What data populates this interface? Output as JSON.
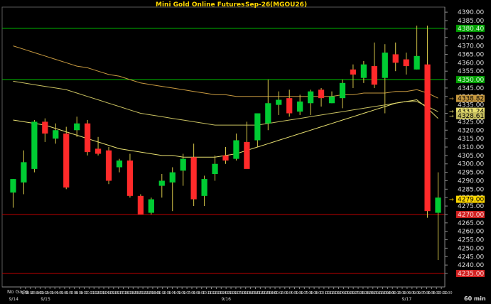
{
  "header": {
    "product": "Mini Gold Online Futures",
    "contract": "Sep-26",
    "symbol": "(MGOU26)"
  },
  "footer": {
    "gaps_label": "No Gaps",
    "interval_label": "60 min"
  },
  "colors": {
    "background": "#000000",
    "up_candle": "#00cc33",
    "down_candle": "#ff2a2a",
    "wick": "#d8c84a",
    "ma_fast": "#e8e070",
    "ma_mid": "#c8c060",
    "ma_slow": "#c89a40",
    "resistance_line": "#00c000",
    "support_line": "#c00000",
    "grid": "#5a5a5a"
  },
  "chart_data": {
    "type": "candlestick",
    "title": "Mini Gold Online Futures  Sep-26  (MGOU26)",
    "interval": "60 min",
    "ylim": [
      4227,
      4393
    ],
    "y_ticks": [
      4235,
      4240,
      4245,
      4250,
      4255,
      4260,
      4265,
      4270,
      4275,
      4280,
      4285,
      4290,
      4295,
      4300,
      4305,
      4310,
      4315,
      4320,
      4325,
      4330,
      4335,
      4340,
      4345,
      4350,
      4355,
      4360,
      4365,
      4370,
      4375,
      4380,
      4385,
      4390
    ],
    "date_labels": [
      {
        "bar": 0,
        "label": "9/14"
      },
      {
        "bar": 3,
        "label": "9/15"
      },
      {
        "bar": 20,
        "label": "9/16"
      },
      {
        "bar": 37,
        "label": "9/17"
      }
    ],
    "time_labels": [
      "1:00",
      "2:00",
      "23:00",
      "0:00",
      "1:00",
      "2:00",
      "3:00",
      "4:00",
      "5:00",
      "6:00",
      "7:00",
      "8:00",
      "9:00",
      "10:00",
      "11:00",
      "12:00",
      "13:00",
      "14:00",
      "15:00",
      "16:00",
      "17:00",
      "18:00",
      "19:00",
      "20:00",
      "21:00",
      "22:00",
      "23:00",
      "0:00",
      "1:00",
      "2:00",
      "3:00",
      "4:00",
      "5:00",
      "6:00",
      "7:00",
      "8:00",
      "9:00",
      "10:00",
      "11:00",
      "12:00",
      "13:00",
      "14:00",
      "15:00",
      "16:00",
      "17:00",
      "18:00",
      "19:00",
      "20:00",
      "21:00",
      "22:00",
      "23:00",
      "0:00",
      "1:00",
      "2:00",
      "3:00",
      "4:00",
      "5:00",
      "6:00",
      "7:00",
      "8:00",
      "9:00",
      "10:00",
      "11:00",
      "12:00",
      "13:00",
      "14:00",
      "15:00",
      "16:00",
      "17:00",
      "18:00",
      "19:00",
      "20:00",
      "21:00",
      "22:00",
      "23:00",
      "0:00",
      "1:00",
      "2:00",
      "3:00",
      "4:00",
      "5:00",
      "6:00",
      "7:00",
      "8:00",
      "9:00",
      "10:00",
      "11:00"
    ],
    "candles": [
      {
        "o": 4283,
        "h": 4291,
        "l": 4274,
        "c": 4291
      },
      {
        "o": 4289,
        "h": 4308,
        "l": 4282,
        "c": 4301
      },
      {
        "o": 4297,
        "h": 4326,
        "l": 4295,
        "c": 4325
      },
      {
        "o": 4325,
        "h": 4327,
        "l": 4313,
        "c": 4318
      },
      {
        "o": 4315,
        "h": 4324,
        "l": 4312,
        "c": 4320
      },
      {
        "o": 4318,
        "h": 4322,
        "l": 4285,
        "c": 4286
      },
      {
        "o": 4320,
        "h": 4328,
        "l": 4316,
        "c": 4324
      },
      {
        "o": 4324,
        "h": 4326,
        "l": 4305,
        "c": 4307
      },
      {
        "o": 4309,
        "h": 4316,
        "l": 4305,
        "c": 4306
      },
      {
        "o": 4308,
        "h": 4310,
        "l": 4288,
        "c": 4290
      },
      {
        "o": 4298,
        "h": 4303,
        "l": 4295,
        "c": 4302
      },
      {
        "o": 4302,
        "h": 4306,
        "l": 4280,
        "c": 4281
      },
      {
        "o": 4281,
        "h": 4282,
        "l": 4270,
        "c": 4270
      },
      {
        "o": 4271,
        "h": 4280,
        "l": 4270,
        "c": 4279
      },
      {
        "o": 4287,
        "h": 4294,
        "l": 4280,
        "c": 4290
      },
      {
        "o": 4289,
        "h": 4298,
        "l": 4272,
        "c": 4295
      },
      {
        "o": 4296,
        "h": 4306,
        "l": 4287,
        "c": 4303
      },
      {
        "o": 4304,
        "h": 4312,
        "l": 4275,
        "c": 4279
      },
      {
        "o": 4281,
        "h": 4293,
        "l": 4275,
        "c": 4291
      },
      {
        "o": 4294,
        "h": 4305,
        "l": 4290,
        "c": 4300
      },
      {
        "o": 4305,
        "h": 4310,
        "l": 4300,
        "c": 4302
      },
      {
        "o": 4303,
        "h": 4318,
        "l": 4302,
        "c": 4314
      },
      {
        "o": 4313,
        "h": 4325,
        "l": 4299,
        "c": 4297
      },
      {
        "o": 4314,
        "h": 4329,
        "l": 4310,
        "c": 4330
      },
      {
        "o": 4324,
        "h": 4350,
        "l": 4320,
        "c": 4336
      },
      {
        "o": 4335,
        "h": 4343,
        "l": 4329,
        "c": 4338
      },
      {
        "o": 4339,
        "h": 4344,
        "l": 4328,
        "c": 4330
      },
      {
        "o": 4331,
        "h": 4341,
        "l": 4329,
        "c": 4337
      },
      {
        "o": 4336,
        "h": 4344,
        "l": 4329,
        "c": 4343
      },
      {
        "o": 4344,
        "h": 4345,
        "l": 4334,
        "c": 4339
      },
      {
        "o": 4336,
        "h": 4343,
        "l": 4336,
        "c": 4340
      },
      {
        "o": 4339,
        "h": 4350,
        "l": 4333,
        "c": 4348
      },
      {
        "o": 4356,
        "h": 4359,
        "l": 4345,
        "c": 4353
      },
      {
        "o": 4351,
        "h": 4361,
        "l": 4348,
        "c": 4359
      },
      {
        "o": 4358,
        "h": 4372,
        "l": 4345,
        "c": 4347
      },
      {
        "o": 4351,
        "h": 4371,
        "l": 4330,
        "c": 4366
      },
      {
        "o": 4365,
        "h": 4372,
        "l": 4355,
        "c": 4360
      },
      {
        "o": 4362,
        "h": 4366,
        "l": 4353,
        "c": 4358
      },
      {
        "o": 4356,
        "h": 4382,
        "l": 4356,
        "c": 4364
      },
      {
        "o": 4359,
        "h": 4382,
        "l": 4268,
        "c": 4272
      },
      {
        "o": 4271,
        "h": 4295,
        "l": 4243,
        "c": 4280
      }
    ],
    "moving_averages": [
      {
        "key": "ma_slow",
        "values": [
          4370,
          4368,
          4366,
          4364,
          4362,
          4360,
          4358,
          4357,
          4355,
          4353,
          4352,
          4350,
          4348,
          4347,
          4346,
          4345,
          4344,
          4343,
          4342,
          4341,
          4341,
          4340,
          4340,
          4340,
          4340,
          4340,
          4340,
          4340,
          4340,
          4340,
          4340,
          4341,
          4341,
          4342,
          4342,
          4342,
          4343,
          4343,
          4344,
          4342,
          4339
        ]
      },
      {
        "key": "ma_mid",
        "values": [
          4349,
          4348,
          4347,
          4346,
          4345,
          4344,
          4342,
          4340,
          4338,
          4336,
          4334,
          4332,
          4330,
          4329,
          4328,
          4327,
          4326,
          4325,
          4324,
          4323,
          4323,
          4323,
          4323,
          4323,
          4324,
          4325,
          4326,
          4327,
          4328,
          4329,
          4330,
          4331,
          4332,
          4333,
          4334,
          4335,
          4336,
          4337,
          4337,
          4334,
          4331
        ]
      },
      {
        "key": "ma_fast",
        "values": [
          4326,
          4325,
          4324,
          4323,
          4321,
          4319,
          4317,
          4315,
          4313,
          4311,
          4309,
          4308,
          4307,
          4306,
          4305,
          4305,
          4304,
          4304,
          4304,
          4304,
          4305,
          4306,
          4308,
          4310,
          4312,
          4314,
          4316,
          4318,
          4320,
          4322,
          4324,
          4326,
          4328,
          4330,
          4332,
          4334,
          4336,
          4337,
          4338,
          4333,
          4327
        ]
      }
    ],
    "horizontal_lines": [
      {
        "value": 4380.4,
        "label": "4380.40",
        "key": "resistance_line"
      },
      {
        "value": 4350.0,
        "label": "4350.00",
        "key": "resistance_line"
      },
      {
        "value": 4270.0,
        "label": "4270.00",
        "key": "support_line"
      },
      {
        "value": 4235.0,
        "label": "4235.00",
        "key": "support_line"
      }
    ],
    "value_tags": [
      {
        "value": 4338.82,
        "label": "4338.82",
        "color": "#c89a40"
      },
      {
        "value": 4331.24,
        "label": "4331.24",
        "color": "#e8e070"
      },
      {
        "value": 4328.61,
        "label": "4328.61",
        "color": "#c8c060"
      },
      {
        "value": 4279.0,
        "label": "4279.00",
        "color": "#ffd800"
      }
    ]
  }
}
